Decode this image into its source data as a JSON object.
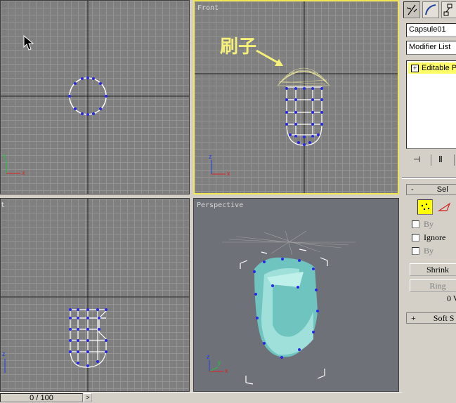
{
  "viewports": {
    "top": {
      "label": ""
    },
    "front": {
      "label": "Front",
      "annotation": "刷子"
    },
    "left": {
      "label": "t"
    },
    "perspective": {
      "label": "Perspective"
    }
  },
  "axis": {
    "x": "x",
    "y": "y",
    "z": "z"
  },
  "command_panel": {
    "object_name": "Capsule01",
    "modifier_list": "Modifier List",
    "stack_item": "Editable P",
    "stack_plus": "+",
    "rollout": {
      "collapse": "-",
      "title": "Sel"
    },
    "checkboxes": [
      {
        "label": "By",
        "dim": true
      },
      {
        "label": "Ignore",
        "dim": false
      },
      {
        "label": "By",
        "dim": true
      }
    ],
    "buttons": {
      "shrink": "Shrink",
      "ring": "Ring"
    },
    "status_text": "0 V",
    "soft_selection": {
      "toggle": "+",
      "title": "Soft S"
    }
  },
  "timeline": {
    "value": "0 / 100",
    "arrow": ">"
  },
  "colors": {
    "active_border": "#f0e650",
    "vertex": "#2828e6",
    "mesh": "#8fd6d0",
    "grid": "#939393"
  }
}
